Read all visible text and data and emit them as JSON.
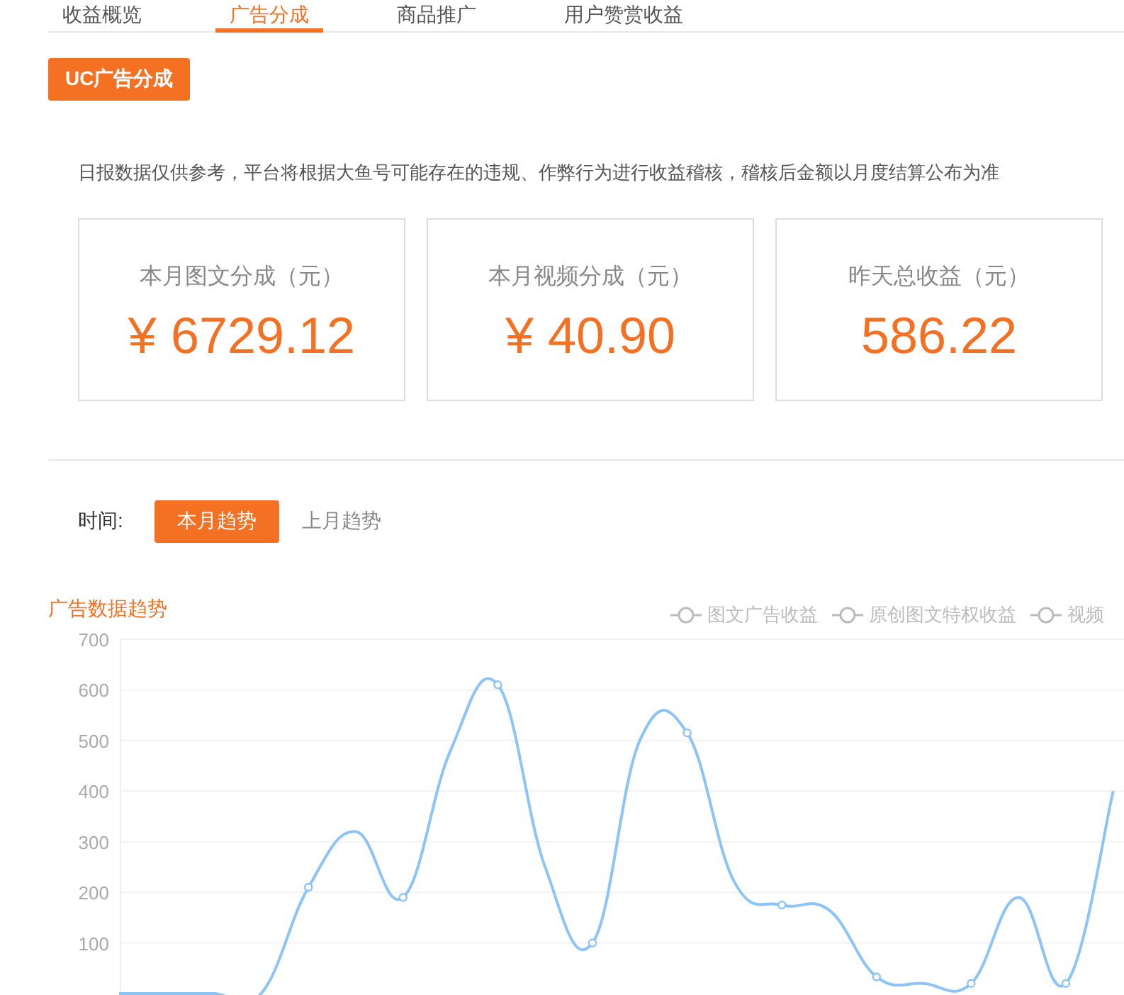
{
  "tabs": [
    {
      "label": "收益概览",
      "selected": false
    },
    {
      "label": "广告分成",
      "selected": true
    },
    {
      "label": "商品推广",
      "selected": false
    },
    {
      "label": "用户赞赏收益",
      "selected": false
    }
  ],
  "section_button": "UC广告分成",
  "notice": "日报数据仅供参考，平台将根据大鱼号可能存在的违规、作弊行为进行收益稽核，稽核后金额以月度结算公布为准",
  "cards": [
    {
      "label": "本月图文分成（元）",
      "value": "¥ 6729.12"
    },
    {
      "label": "本月视频分成（元）",
      "value": "¥ 40.90"
    },
    {
      "label": "昨天总收益（元）",
      "value": "586.22"
    }
  ],
  "time_filter": {
    "label": "时间:",
    "options": [
      {
        "label": "本月趋势",
        "selected": true
      },
      {
        "label": "上月趋势",
        "selected": false
      }
    ]
  },
  "chart": {
    "legend_extra": [
      "原创图文特权收益",
      "视频"
    ],
    "chart_data": {
      "type": "line",
      "title": "广告数据趋势",
      "grid": true,
      "ylim": [
        0,
        700
      ],
      "yticks": [
        100,
        200,
        300,
        400,
        500,
        600,
        700
      ],
      "series": [
        {
          "name": "图文广告收益",
          "color": "#8cc4f7",
          "values": [
            0,
            0,
            0,
            0,
            210,
            320,
            190,
            480,
            610,
            250,
            100,
            500,
            515,
            220,
            175,
            165,
            33,
            20,
            20,
            190,
            20,
            400
          ]
        }
      ]
    }
  }
}
